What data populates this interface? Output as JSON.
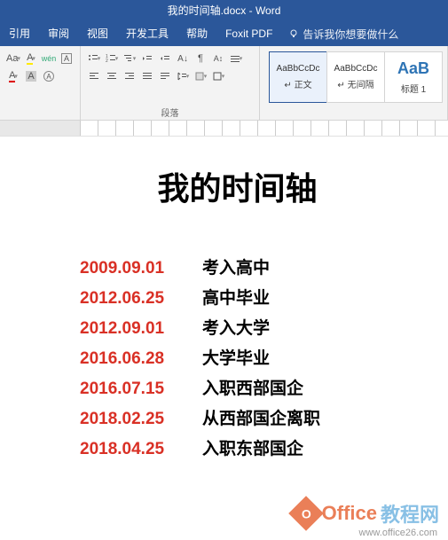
{
  "title": "我的时间轴.docx - Word",
  "tabs": [
    "引用",
    "审阅",
    "视图",
    "开发工具",
    "帮助",
    "Foxit PDF"
  ],
  "tellme_icon": "lightbulb-icon",
  "tellme": "告诉我你想要做什么",
  "font_group": {
    "label": "",
    "row1": [
      "Aa",
      "A",
      "wén"
    ],
    "row2": [
      "A",
      "A",
      "A"
    ]
  },
  "para_group": {
    "label": "段落"
  },
  "styles": [
    {
      "preview": "AaBbCcDc",
      "name": "↵ 正文",
      "selected": true
    },
    {
      "preview": "AaBbCcDc",
      "name": "↵ 无间隔",
      "selected": false
    },
    {
      "preview": "AaB",
      "name": "标题 1",
      "selected": false,
      "big": true
    }
  ],
  "doc": {
    "heading": "我的时间轴",
    "rows": [
      {
        "date": "2009.09.01",
        "event": "考入高中"
      },
      {
        "date": "2012.06.25",
        "event": "高中毕业"
      },
      {
        "date": "2012.09.01",
        "event": "考入大学"
      },
      {
        "date": "2016.06.28",
        "event": "大学毕业"
      },
      {
        "date": "2016.07.15",
        "event": "入职西部国企"
      },
      {
        "date": "2018.02.25",
        "event": "从西部国企离职"
      },
      {
        "date": "2018.04.25",
        "event": "入职东部国企"
      }
    ]
  },
  "watermark": {
    "t1": "Office",
    "t2": "教程网",
    "url": "www.office26.com"
  }
}
